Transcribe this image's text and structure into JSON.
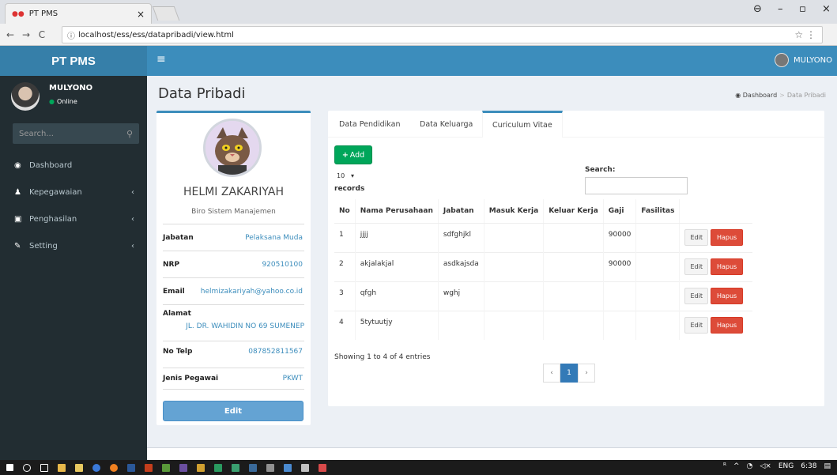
{
  "browser": {
    "tab_title": "PT PMS",
    "url": "localhost/ess/ess/datapribadi/view.html"
  },
  "header": {
    "brand": "PT PMS",
    "user": "MULYONO"
  },
  "sidebar": {
    "user_name": "MULYONO",
    "status": "Online",
    "search_placeholder": "Search...",
    "items": [
      {
        "label": "Dashboard",
        "icon": "dashboard-icon"
      },
      {
        "label": "Kepegawaian",
        "icon": "user-icon"
      },
      {
        "label": "Penghasilan",
        "icon": "money-icon"
      },
      {
        "label": "Setting",
        "icon": "wrench-icon"
      }
    ]
  },
  "page": {
    "title": "Data Pribadi",
    "breadcrumb": [
      "Dashboard",
      "Data Pribadi"
    ]
  },
  "profile": {
    "name": "HELMI ZAKARIYAH",
    "unit": "Biro Sistem Manajemen",
    "fields": [
      {
        "label": "Jabatan",
        "value": "Pelaksana Muda"
      },
      {
        "label": "NRP",
        "value": "920510100"
      },
      {
        "label": "Email",
        "value": "helmizakariyah@yahoo.co.id"
      },
      {
        "label": "Alamat",
        "value": "JL. DR. WAHIDIN NO 69 SUMENEP"
      },
      {
        "label": "No Telp",
        "value": "087852811567"
      },
      {
        "label": "Jenis Pegawai",
        "value": "PKWT"
      }
    ],
    "edit_label": "Edit"
  },
  "tabs": [
    {
      "label": "Data Pendidikan",
      "active": false
    },
    {
      "label": "Data Keluarga",
      "active": false
    },
    {
      "label": "Curiculum Vitae",
      "active": true
    }
  ],
  "cv": {
    "add_label": "Add",
    "length_value": "10",
    "records_label": "records",
    "search_label": "Search:",
    "columns": [
      "No",
      "Nama Perusahaan",
      "Jabatan",
      "Masuk Kerja",
      "Keluar Kerja",
      "Gaji",
      "Fasilitas"
    ],
    "rows": [
      {
        "no": "1",
        "perusahaan": "jjjj",
        "jabatan": "sdfghjkl",
        "masuk": "",
        "keluar": "",
        "gaji": "90000",
        "fasilitas": ""
      },
      {
        "no": "2",
        "perusahaan": "akjalakjal",
        "jabatan": "asdkajsda",
        "masuk": "",
        "keluar": "",
        "gaji": "90000",
        "fasilitas": ""
      },
      {
        "no": "3",
        "perusahaan": "qfgh",
        "jabatan": "wghj",
        "masuk": "",
        "keluar": "",
        "gaji": "",
        "fasilitas": ""
      },
      {
        "no": "4",
        "perusahaan": "5tytuutjy",
        "jabatan": "",
        "masuk": "",
        "keluar": "",
        "gaji": "",
        "fasilitas": ""
      }
    ],
    "edit_label": "Edit",
    "delete_label": "Hapus",
    "showing": "Showing 1 to 4 of 4 entries",
    "pager": {
      "prev": "‹",
      "page": "1",
      "next": "›"
    }
  },
  "taskbar": {
    "lang": "ENG",
    "time": "6:38"
  }
}
